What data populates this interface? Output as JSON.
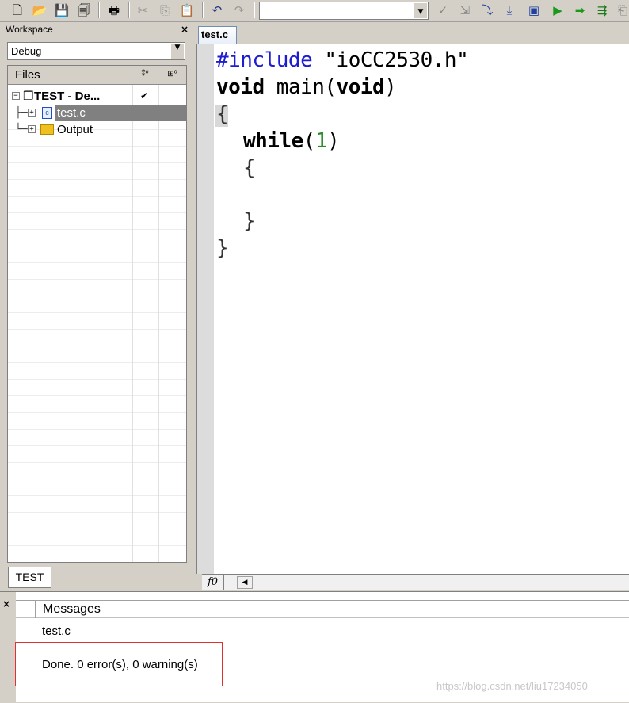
{
  "toolbar": {
    "icons": [
      "new-file",
      "open-folder",
      "save",
      "save-all",
      "print",
      "cut",
      "copy",
      "paste",
      "undo",
      "redo",
      "find-combo",
      "check",
      "make",
      "debug",
      "stop",
      "step-over",
      "run",
      "go",
      "step",
      "step-into"
    ],
    "combo_value": ""
  },
  "workspace": {
    "title": "Workspace",
    "close": "×",
    "config": "Debug",
    "columns": {
      "files": "Files",
      "col_a": "⁑⁰",
      "col_b": "⊞⁰"
    },
    "tree": [
      {
        "label": "TEST - De...",
        "check": "✔"
      },
      {
        "label": "test.c",
        "selected": true
      },
      {
        "label": "Output"
      }
    ],
    "tab": "TEST"
  },
  "editor": {
    "tab": "test.c",
    "code": {
      "l1_pp": "#include",
      "l1_str": " \"ioCC2530.h\"",
      "l2_kw1": "void",
      "l2_mid": " main(",
      "l2_kw2": "void",
      "l2_end": ")",
      "l3": "{",
      "l4_kw": "while",
      "l4_open": "(",
      "l4_num": "1",
      "l4_close": ")",
      "l5": "{",
      "l6": "}",
      "l7": "}"
    },
    "hscroll_f": "f0"
  },
  "messages": {
    "close": "×",
    "header": "Messages",
    "lines": [
      "test.c",
      "Done. 0 error(s), 0 warning(s)"
    ]
  },
  "watermark": "https://blog.csdn.net/liu17234050"
}
